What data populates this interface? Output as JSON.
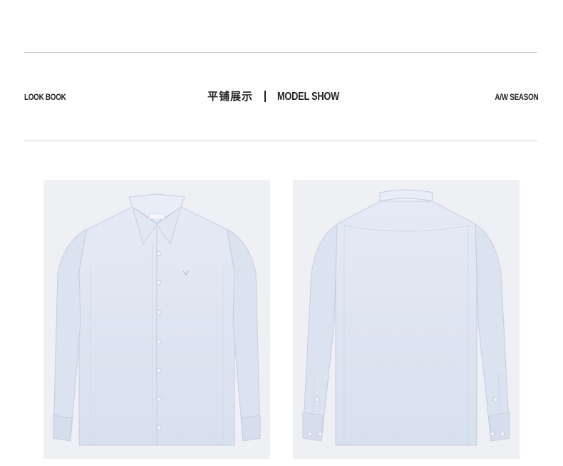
{
  "header": {
    "left_label": "LOOK BOOK",
    "title_cn": "平铺展示",
    "title_en": "MODEL SHOW",
    "right_label": "A/W SEASON"
  },
  "gallery": {
    "items": [
      {
        "view": "front",
        "icon": "shirt-front-icon"
      },
      {
        "view": "back",
        "icon": "shirt-back-icon"
      }
    ]
  },
  "colors": {
    "shirt": "#dde5f2",
    "shirt_shadow": "#c8d2e4",
    "photo_background": "#eef0f3",
    "rule": "#c9c9c9"
  }
}
